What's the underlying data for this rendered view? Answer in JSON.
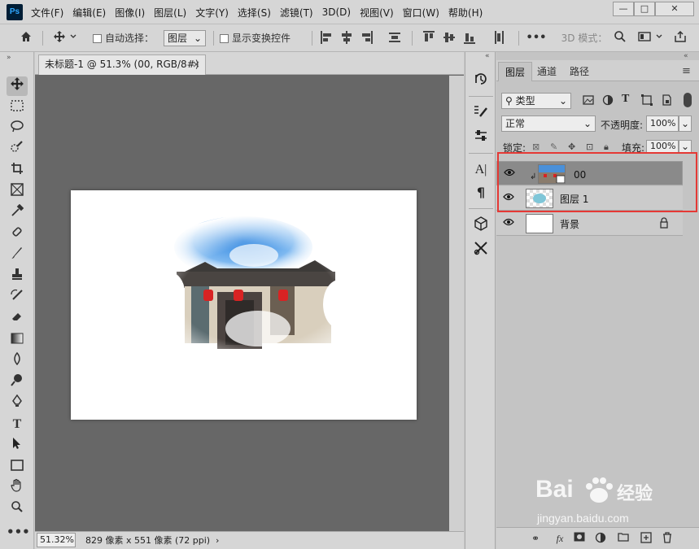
{
  "app": {
    "logo": "Ps"
  },
  "menu": [
    "文件(F)",
    "编辑(E)",
    "图像(I)",
    "图层(L)",
    "文字(Y)",
    "选择(S)",
    "滤镜(T)",
    "3D(D)",
    "视图(V)",
    "窗口(W)",
    "帮助(H)"
  ],
  "window_controls": {
    "minimize": "—",
    "maximize": "□",
    "close": "✕"
  },
  "options": {
    "auto_select_label": "自动选择：",
    "auto_select_value": "图层",
    "show_transform_label": "显示变换控件",
    "more": "•••",
    "mode_3d": "3D 模式："
  },
  "document": {
    "tab_title": "未标题-1 @ 51.3% (00, RGB/8#) *",
    "tab_close": "×",
    "zoom": "51.32%",
    "status": "829 像素 x 551 像素 (72 ppi)",
    "status_arrow": "›"
  },
  "layers_panel": {
    "tabs": [
      "图层",
      "通道",
      "路径"
    ],
    "filter_value": "类型",
    "blend_mode": "正常",
    "opacity_label": "不透明度:",
    "opacity_value": "100%",
    "lock_label": "锁定:",
    "fill_label": "填充:",
    "fill_value": "100%",
    "layers": [
      {
        "name": "00",
        "selected": true
      },
      {
        "name": "图层 1",
        "selected": false
      },
      {
        "name": "背景",
        "selected": false,
        "locked": true
      }
    ]
  },
  "watermark": {
    "brand": "Bai",
    "brand2": "经验",
    "url": "jingyan.baidu.com"
  },
  "colors": {
    "highlight": "#e53935",
    "selected_row": "#8a8a8a",
    "panel": "#c4c4c4",
    "canvas_bg": "#676767"
  }
}
